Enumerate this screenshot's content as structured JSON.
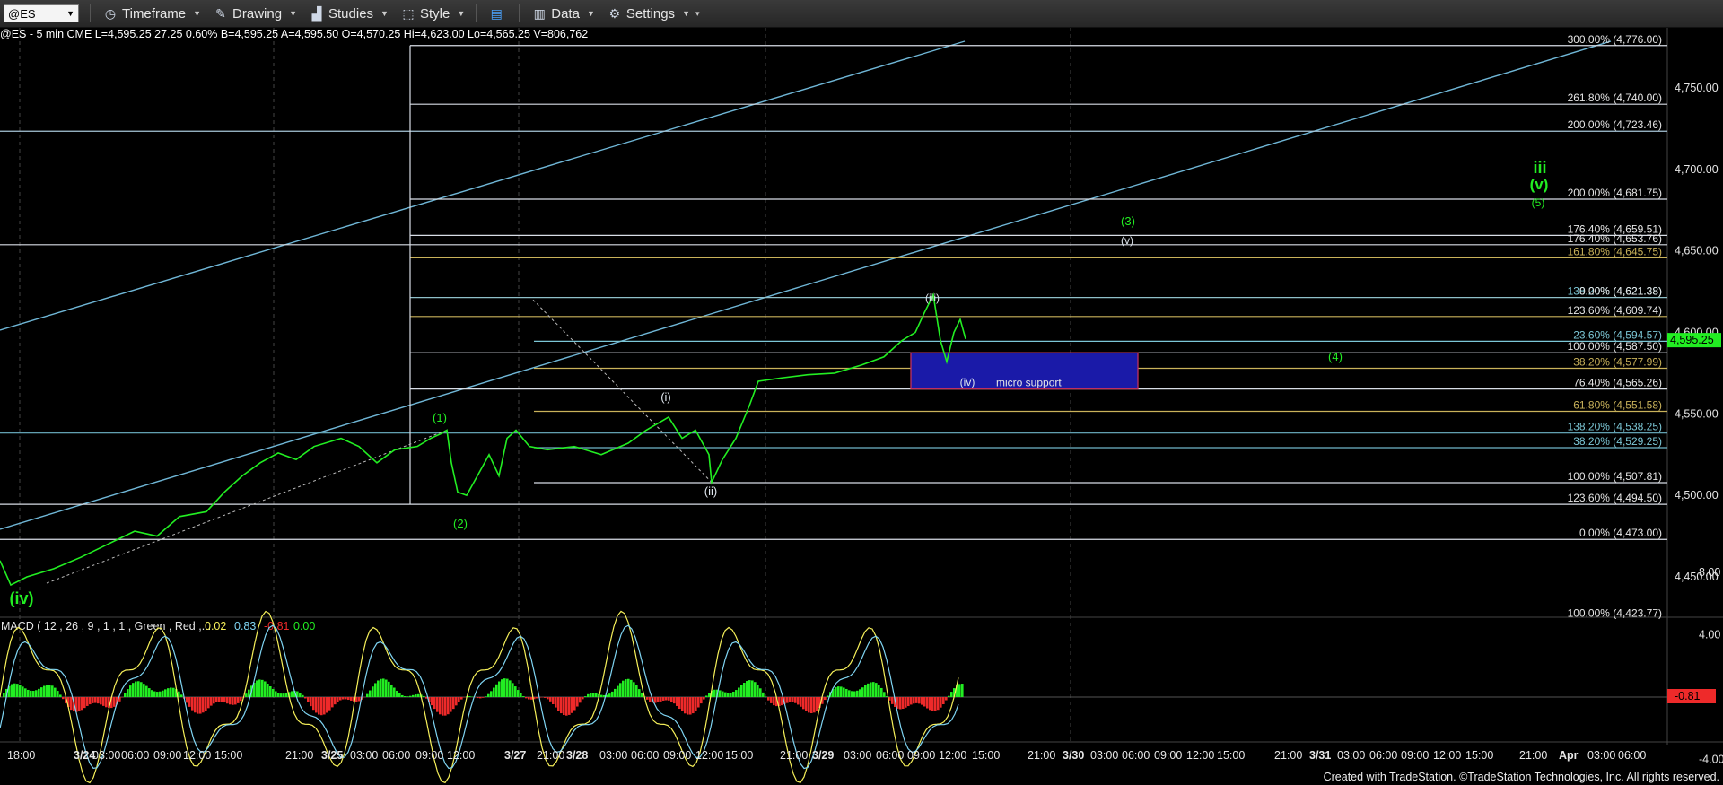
{
  "toolbar": {
    "symbol": "@ES",
    "timeframe": "Timeframe",
    "drawing": "Drawing",
    "studies": "Studies",
    "style": "Style",
    "data": "Data",
    "settings": "Settings"
  },
  "infobar": "@ES - 5 min  CME  L=4,595.25  27.25  0.60%  B=4,595.25  A=4,595.50  O=4,570.25  Hi=4,623.00  Lo=4,565.25  V=806,762",
  "colors": {
    "price": "#22ee22",
    "fib": "#d8dde6",
    "channel": "#6fb6d6",
    "support": "#1a1aa8"
  },
  "price_axis": {
    "ticks": [
      "4,750.00",
      "4,700.00",
      "4,650.00",
      "4,600.00",
      "4,550.00",
      "4,500.00",
      "4,450.00"
    ],
    "current": "4,595.25"
  },
  "macd": {
    "title": "MACD ( 12 , 26 , 9 , 1 , 1 , Green , Red ,... ",
    "vals": [
      "0.02",
      "0.83",
      "-0.81",
      "0.00"
    ],
    "ticks": [
      "8.00",
      "4.00",
      "-4.00"
    ],
    "current": "-0.81"
  },
  "time_axis": [
    "18:00",
    "3/24",
    "03:00",
    "06:00",
    "09:00",
    "12:00",
    "15:00",
    "21:00",
    "3/25",
    "03:00",
    "06:00",
    "09:00",
    "12:00",
    "3/27",
    "21:00",
    "3/28",
    "03:00",
    "06:00",
    "09:00",
    "12:00",
    "15:00",
    "21:00",
    "3/29",
    "03:00",
    "06:00",
    "09:00",
    "12:00",
    "15:00",
    "21:00",
    "3/30",
    "03:00",
    "06:00",
    "09:00",
    "12:00",
    "15:00",
    "21:00",
    "3/31",
    "03:00",
    "06:00",
    "09:00",
    "12:00",
    "15:00",
    "21:00",
    "Apr",
    "03:00",
    "06:00"
  ],
  "fib_labels": [
    "300.00% (4,776.00)",
    "261.80% (4,740.00)",
    "200.00% (4,723.46)",
    "200.00% (4,681.75)",
    "176.40% (4,659.51)",
    "176.40% (4,653.76)",
    "161.80% (4,645.75)",
    "138.20% (4,621.38)",
    "0.00% (4,621.38)",
    "123.60% (4,609.74)",
    "23.60% (4,594.57)",
    "100.00% (4,587.50)",
    "38.20% (4,577.99)",
    "76.40% (4,565.26)",
    "61.80% (4,551.58)",
    "138.20% (4,538.25)",
    "38.20% (4,529.25)",
    "100.00% (4,507.81)",
    "123.60% (4,494.50)",
    "0.00% (4,473.00)",
    "100.00% (4,423.77)"
  ],
  "wave_labels": [
    "(iv)",
    "(1)",
    "(2)",
    "(i)",
    "(ii)",
    "(iii)",
    "(iv)",
    "(3)",
    "(v)",
    "(4)",
    "iii",
    "(v)",
    "(5)"
  ],
  "annotation": "micro support",
  "footer": "Created with TradeStation. ©TradeStation Technologies, Inc. All rights reserved.",
  "chart_data": {
    "type": "line",
    "title": "@ES - 5 min",
    "price_range": [
      4423.77,
      4776.0
    ],
    "fib_levels": [
      4776.0,
      4740.0,
      4723.46,
      4681.75,
      4659.51,
      4653.76,
      4645.75,
      4621.38,
      4609.74,
      4594.57,
      4587.5,
      4577.99,
      4565.26,
      4551.58,
      4538.25,
      4529.25,
      4507.81,
      4494.5,
      4473.0,
      4423.77
    ],
    "support_zone": [
      4565.26,
      4587.5
    ],
    "last_price": 4595.25,
    "high": 4623.0,
    "low": 4565.25
  }
}
